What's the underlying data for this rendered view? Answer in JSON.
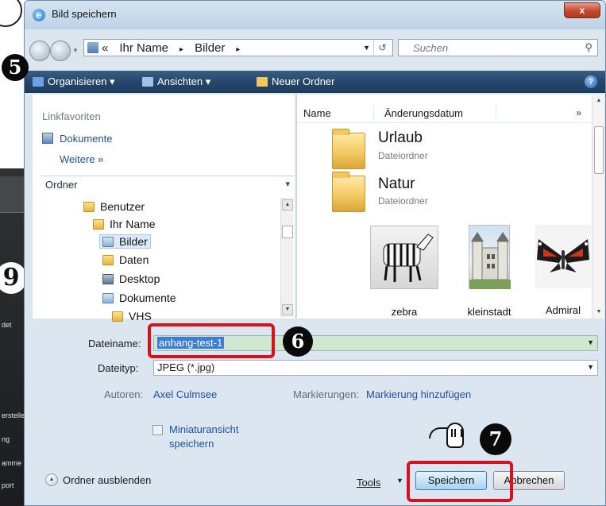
{
  "window": {
    "title": "Bild speichern",
    "close_label": "x"
  },
  "address": {
    "crumbs": [
      "«",
      "Ihr Name",
      "▸",
      "Bilder",
      "▸"
    ],
    "refresh_glyph": "↺",
    "search_placeholder": "Suchen"
  },
  "toolbar": {
    "organize": "Organisieren",
    "views": "Ansichten",
    "new_folder": "Neuer Ordner"
  },
  "nav": {
    "favorites_heading": "Linkfavoriten",
    "favorites": [
      {
        "label": "Dokumente",
        "icon": "document-icon"
      },
      {
        "label": "Weitere »",
        "icon": ""
      }
    ],
    "folders_heading": "Ordner",
    "tree": [
      {
        "label": "Benutzer",
        "icon": "folder-icon"
      },
      {
        "label": "Ihr Name",
        "icon": "folder-icon"
      },
      {
        "label": "Bilder",
        "icon": "pictures-folder-icon",
        "selected": true
      },
      {
        "label": "Daten",
        "icon": "folder-icon"
      },
      {
        "label": "Desktop",
        "icon": "desktop-folder-icon"
      },
      {
        "label": "Dokumente",
        "icon": "documents-folder-icon"
      },
      {
        "label": "VHS",
        "icon": "folder-icon"
      }
    ]
  },
  "files": {
    "columns": [
      "Name",
      "Änderungsdatum",
      "»"
    ],
    "folders": [
      {
        "name": "Urlaub",
        "type": "Dateiordner"
      },
      {
        "name": "Natur",
        "type": "Dateiordner"
      }
    ],
    "images": [
      {
        "label": "zebra",
        "icon": "zebra-thumbnail"
      },
      {
        "label": "kleinstadt",
        "icon": "castle-thumbnail"
      },
      {
        "label": "Admiral",
        "icon": "butterfly-thumbnail"
      }
    ]
  },
  "form": {
    "filename_label": "Dateiname:",
    "filename_value": "anhang-test-1",
    "filetype_label": "Dateityp:",
    "filetype_value": "JPEG (*.jpg)",
    "authors_label": "Autoren:",
    "authors_value": "Axel Culmsee",
    "tags_label": "Markierungen:",
    "tags_value": "Markierung hinzufügen",
    "thumbnail_label_1": "Miniaturansicht",
    "thumbnail_label_2": "speichern",
    "hide_folders": "Ordner ausblenden",
    "tools": "Tools",
    "save": "Speichern",
    "cancel": "Abbrechen"
  },
  "annotations": {
    "step5": "5",
    "step6": "6",
    "step7": "7",
    "step9": "9"
  },
  "left_panel": {
    "items": [
      "det",
      "erstellen",
      "ng",
      "amme",
      "port"
    ]
  },
  "colors": {
    "accent_red": "#d8121c",
    "toolbar_blue": "#25476b",
    "link_blue": "#1f4e99"
  }
}
